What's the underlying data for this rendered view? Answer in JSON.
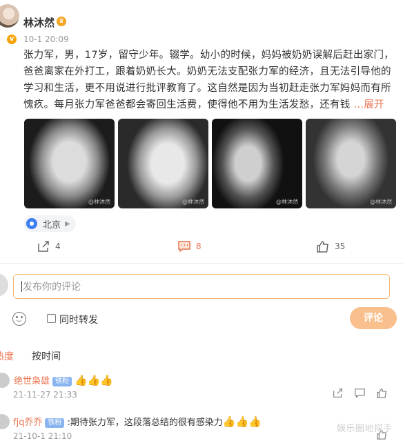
{
  "post": {
    "author": "林沐然",
    "time": "10-1 20:09",
    "body": "张力军，男，17岁，留守少年。辍学。幼小的时候，妈妈被奶奶误解后赶出家门，爸爸离家在外打工，跟着奶奶长大。奶奶无法支配张力军的经济，且无法引导他的学习和生活，更不用说进行批评教育了。这自然是因为当初赶走张力军妈妈而有所愧疚。每月张力军爸爸都会寄回生活费，使得他不用为生活发愁，还有钱",
    "more": " ...展开",
    "location": "北京",
    "photos": [
      {
        "watermark": "@林沐然"
      },
      {
        "watermark": "@林沐然"
      },
      {
        "watermark": "@林沐然"
      },
      {
        "watermark": "@林沐然"
      }
    ],
    "actions": {
      "forward": "4",
      "comment": "8",
      "like": "35"
    }
  },
  "composer": {
    "placeholder": "发布你的评论",
    "also_forward": "同时转发",
    "submit": "评论"
  },
  "sort": {
    "hot": "热度",
    "time": "按时间"
  },
  "comments": [
    {
      "user": "绝世枭雄",
      "badge": "铁粉",
      "text": "",
      "time": "21-11-27 21:33"
    },
    {
      "user": "fjq乔乔",
      "badge": "铁粉",
      "text": ":期待张力军，这段落总结的很有感染力",
      "time": "21-10-1 21:10"
    }
  ],
  "watermark_text": "娱乐圈地探手"
}
